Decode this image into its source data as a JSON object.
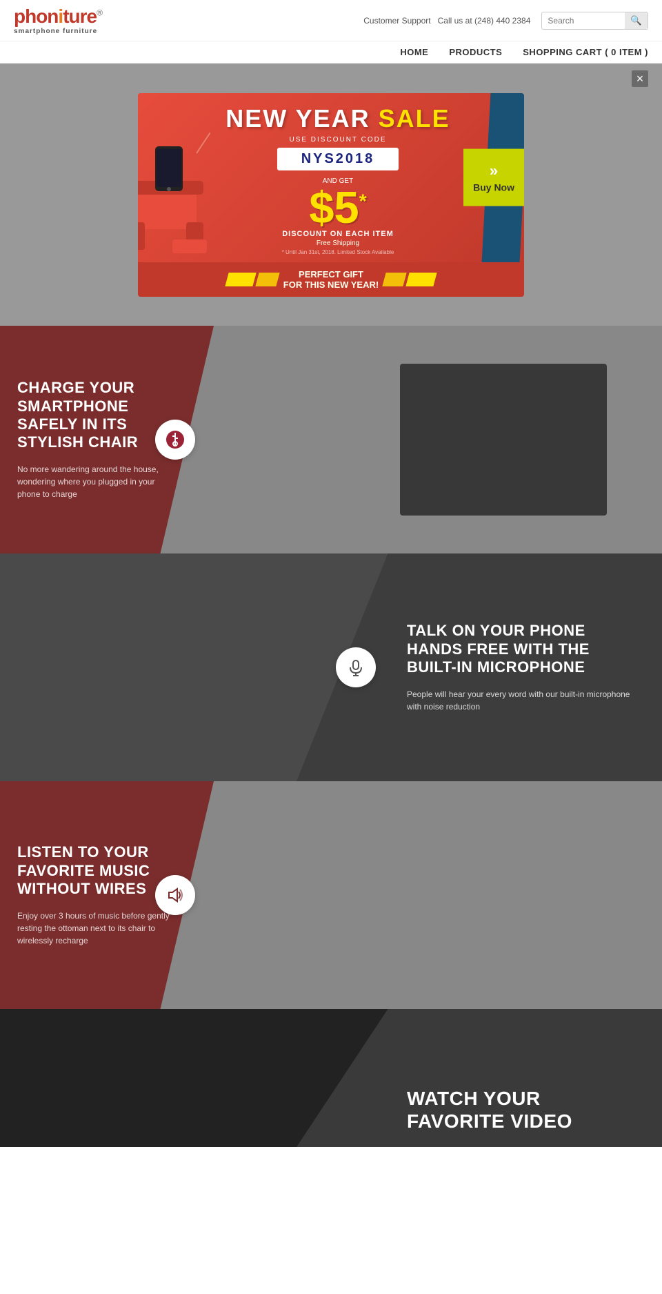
{
  "header": {
    "logo": "phoniture",
    "logo_r": "®",
    "logo_sub_bold": "smart",
    "logo_sub_rest": "phone furniture",
    "customer_support": "Customer Support",
    "phone_label": "Call us at (248) 440 2384",
    "search_placeholder": "Search"
  },
  "nav": {
    "items": [
      {
        "label": "HOME",
        "id": "home"
      },
      {
        "label": "PRODUCTS",
        "id": "products"
      },
      {
        "label": "SHOPPING CART ( 0 ITEM )",
        "id": "cart"
      }
    ]
  },
  "promo": {
    "close_label": "×",
    "new_year": "NEW YEAR",
    "sale": "SALE",
    "use_code": "USE DISCOUNT CODE",
    "code": "NYS2018",
    "and_get": "AND GET",
    "price": "$5",
    "asterisk": "*",
    "discount_text": "DISCOUNT ON EACH ITEM",
    "free_shipping": "Free Shipping",
    "fine_print": "* Until Jan 31st, 2018. Limited Stock Available",
    "buy_now": "Buy\nNow",
    "arrows": "»",
    "gift_text": "PERFECT GIFT\nFOR THIS NEW YEAR!"
  },
  "features": [
    {
      "id": "charge",
      "title": "CHARGE YOUR SMARTPHONE SAFELY IN ITS STYLISH CHAIR",
      "description": "No more wandering around the house, wondering where you plugged in your phone to charge",
      "icon": "usb-icon",
      "align": "left"
    },
    {
      "id": "microphone",
      "title": "TALK ON YOUR PHONE HANDS FREE WITH THE BUILT-IN MICROPHONE",
      "description": "People will hear your every word with our built-in microphone with noise reduction",
      "icon": "microphone-icon",
      "align": "right"
    },
    {
      "id": "music",
      "title": "LISTEN TO YOUR FAVORITE MUSIC WITHOUT WIRES",
      "description": "Enjoy over 3 hours of music before gently resting the ottoman next to its chair to wirelessly recharge",
      "icon": "speaker-icon",
      "align": "left"
    },
    {
      "id": "watch",
      "title": "WATCH YOUR FAVORITE VIDEO",
      "description": "",
      "icon": "play-icon",
      "align": "right"
    }
  ],
  "colors": {
    "red": "#c0392b",
    "dark_red": "#7b2d2d",
    "yellow": "#ffe100",
    "dark_bg": "#4a4a4a",
    "medium_bg": "#888888"
  }
}
